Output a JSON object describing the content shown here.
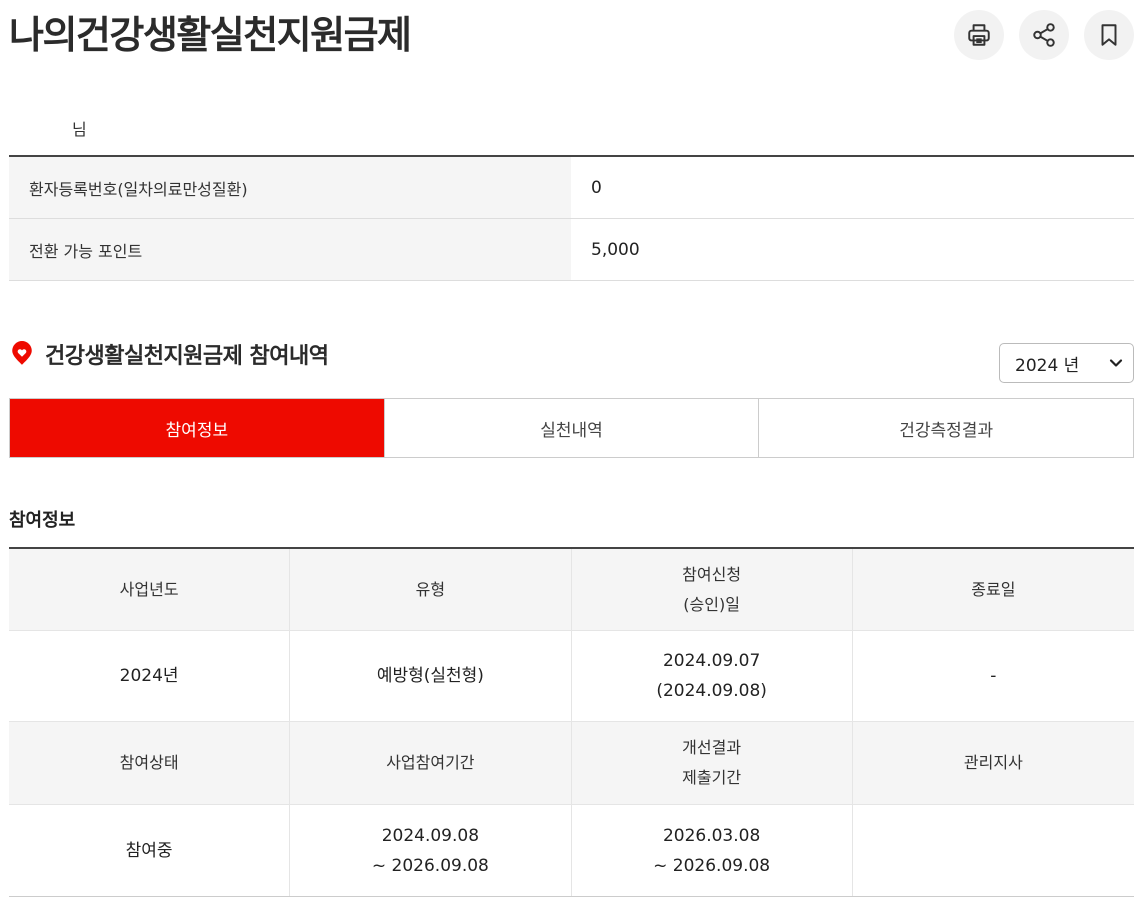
{
  "header": {
    "title": "나의건강생활실천지원금제",
    "actions": [
      {
        "name": "print-icon"
      },
      {
        "name": "share-icon"
      },
      {
        "name": "bookmark-icon"
      }
    ]
  },
  "user": {
    "name_suffix": "님"
  },
  "info": {
    "rows": [
      {
        "label": "환자등록번호(일차의료만성질환)",
        "value": "0"
      },
      {
        "label": "전환 가능 포인트",
        "value": "5,000"
      }
    ]
  },
  "section": {
    "title": "건강생활실천지원금제 참여내역",
    "icon": "heart-pin-icon",
    "year_select": "2024 년"
  },
  "tabs": [
    {
      "label": "참여정보",
      "active": true
    },
    {
      "label": "실천내역",
      "active": false
    },
    {
      "label": "건강측정결과",
      "active": false
    }
  ],
  "participation": {
    "title": "참여정보",
    "head1": [
      "사업년도",
      "유형",
      "참여신청\n(승인)일",
      "종료일"
    ],
    "row1": [
      "2024년",
      "예방형(실천형)",
      "2024.09.07\n(2024.09.08)",
      "-"
    ],
    "head2": [
      "참여상태",
      "사업참여기간",
      "개선결과\n제출기간",
      "관리지사"
    ],
    "row2": [
      "참여중",
      "2024.09.08\n~ 2026.09.08",
      "2026.03.08\n~ 2026.09.08",
      ""
    ]
  },
  "colors": {
    "accent": "#ee0a00",
    "header_bg": "#f5f5f5"
  }
}
